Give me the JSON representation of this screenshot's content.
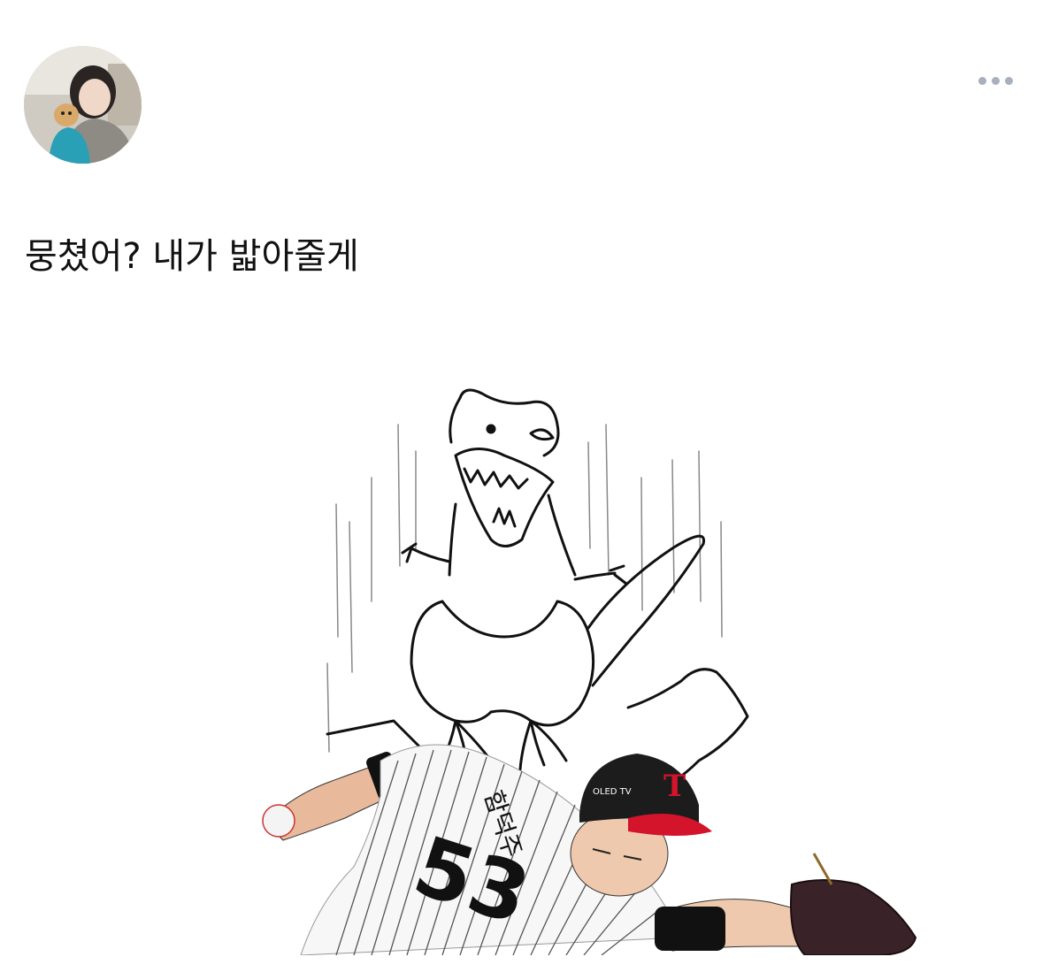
{
  "post": {
    "text": "뭉쳤어? 내가 밟아줄게"
  },
  "author": {
    "avatar_icon": "profile-photo"
  },
  "actions": {
    "more_icon": "more-horizontal-icon"
  },
  "media": {
    "jersey_number": "53",
    "cap_text": "OLED TV",
    "cap_logo": "T",
    "back_name": "함덕주"
  },
  "colors": {
    "text": "#111111",
    "icon_gray": "#a7b0bc",
    "cap_red": "#d3142a",
    "cap_black": "#1c1c1c"
  }
}
